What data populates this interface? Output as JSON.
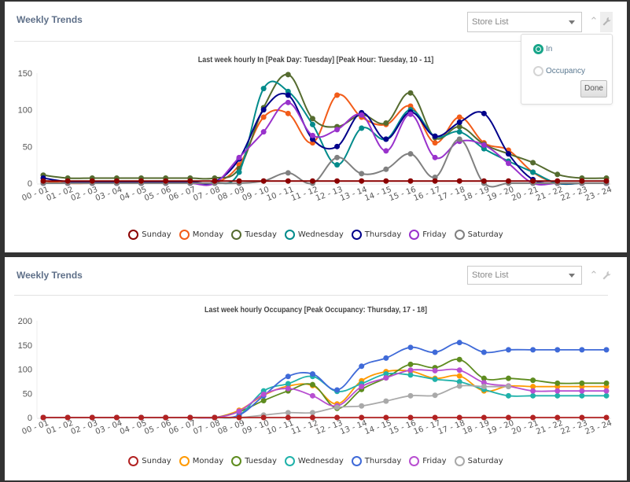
{
  "panels": [
    {
      "title": "Weekly Trends",
      "store_select": {
        "placeholder": "Store List"
      },
      "popup": {
        "visible": true,
        "options": [
          {
            "label": "In",
            "selected": true
          },
          {
            "label": "Occupancy",
            "selected": false
          }
        ],
        "done_label": "Done"
      }
    },
    {
      "title": "Weekly Trends",
      "store_select": {
        "placeholder": "Store List"
      }
    }
  ],
  "chart_data": [
    {
      "type": "line",
      "title": "Last week hourly In [Peak Day: Tuesday] [Peak Hour: Tuesday, 10 - 11]",
      "xlabel": "",
      "ylabel": "",
      "ylim": [
        0,
        150
      ],
      "yticks": [
        0,
        50,
        100,
        150
      ],
      "grid": false,
      "legend": "bottom",
      "categories": [
        "00 - 01",
        "01 - 02",
        "02 - 03",
        "03 - 04",
        "04 - 05",
        "05 - 06",
        "06 - 07",
        "07 - 08",
        "08 - 09",
        "09 - 10",
        "10 - 11",
        "11 - 12",
        "12 - 13",
        "13 - 14",
        "14 - 15",
        "15 - 16",
        "16 - 17",
        "17 - 18",
        "18 - 19",
        "19 - 20",
        "20 - 21",
        "21 - 22",
        "22 - 23",
        "23 - 24"
      ],
      "series": [
        {
          "name": "Sunday",
          "color": "#8b0000",
          "values": [
            3,
            3,
            3,
            3,
            3,
            3,
            3,
            3,
            3,
            3,
            3,
            3,
            3,
            3,
            3,
            3,
            3,
            3,
            3,
            3,
            3,
            3,
            3,
            3
          ]
        },
        {
          "name": "Monday",
          "color": "#f25c19",
          "values": [
            3,
            0,
            0,
            0,
            0,
            0,
            0,
            0,
            25,
            90,
            95,
            55,
            120,
            90,
            80,
            105,
            55,
            90,
            55,
            45,
            15,
            0,
            0,
            0
          ]
        },
        {
          "name": "Tuesday",
          "color": "#556b2f",
          "values": [
            11,
            7,
            7,
            7,
            7,
            7,
            7,
            7,
            20,
            103,
            148,
            88,
            77,
            93,
            82,
            123,
            62,
            77,
            53,
            40,
            28,
            12,
            7,
            7
          ]
        },
        {
          "name": "Wednesday",
          "color": "#008b8b",
          "values": [
            0,
            0,
            0,
            0,
            0,
            0,
            0,
            0,
            15,
            129,
            125,
            80,
            25,
            75,
            60,
            100,
            64,
            70,
            47,
            30,
            15,
            0,
            0,
            0
          ]
        },
        {
          "name": "Thursday",
          "color": "#00008b",
          "values": [
            7,
            2,
            2,
            2,
            2,
            2,
            2,
            2,
            33,
            100,
            120,
            60,
            50,
            96,
            60,
            97,
            64,
            83,
            95,
            40,
            5,
            0,
            0,
            0
          ]
        },
        {
          "name": "Friday",
          "color": "#9932cc",
          "values": [
            0,
            0,
            0,
            0,
            0,
            0,
            0,
            0,
            35,
            70,
            110,
            65,
            73,
            93,
            44,
            94,
            35,
            57,
            52,
            27,
            0,
            0,
            0,
            0
          ]
        },
        {
          "name": "Saturday",
          "color": "#808080",
          "values": [
            0,
            0,
            0,
            0,
            0,
            0,
            0,
            0,
            0,
            3,
            14,
            0,
            35,
            13,
            19,
            40,
            8,
            60,
            0,
            0,
            0,
            0,
            0,
            0
          ]
        }
      ]
    },
    {
      "type": "line",
      "title": "Last week hourly Occupancy [Peak Occupancy: Thursday, 17 - 18]",
      "xlabel": "",
      "ylabel": "",
      "ylim": [
        0,
        200
      ],
      "yticks": [
        0,
        50,
        100,
        150,
        200
      ],
      "grid": false,
      "legend": "bottom",
      "categories": [
        "00 - 01",
        "01 - 02",
        "02 - 03",
        "03 - 04",
        "04 - 05",
        "05 - 06",
        "06 - 07",
        "07 - 08",
        "08 - 09",
        "09 - 10",
        "10 - 11",
        "11 - 12",
        "12 - 13",
        "13 - 14",
        "14 - 15",
        "15 - 16",
        "16 - 17",
        "17 - 18",
        "18 - 19",
        "19 - 20",
        "20 - 21",
        "21 - 22",
        "22 - 23",
        "23 - 24"
      ],
      "series": [
        {
          "name": "Sunday",
          "color": "#b22222",
          "values": [
            0,
            0,
            0,
            0,
            0,
            0,
            0,
            0,
            0,
            0,
            0,
            0,
            0,
            0,
            0,
            0,
            0,
            0,
            0,
            0,
            0,
            0,
            0,
            0
          ]
        },
        {
          "name": "Monday",
          "color": "#ff9900",
          "values": [
            0,
            0,
            0,
            0,
            0,
            0,
            0,
            0,
            15,
            46,
            65,
            66,
            28,
            76,
            95,
            96,
            81,
            86,
            55,
            65,
            64,
            64,
            64,
            64
          ]
        },
        {
          "name": "Tuesday",
          "color": "#5e8c1f",
          "values": [
            0,
            0,
            0,
            0,
            0,
            0,
            0,
            0,
            12,
            35,
            55,
            68,
            19,
            58,
            82,
            110,
            103,
            120,
            81,
            81,
            77,
            71,
            71,
            71
          ]
        },
        {
          "name": "Wednesday",
          "color": "#20b2aa",
          "values": [
            0,
            0,
            0,
            0,
            0,
            0,
            0,
            0,
            5,
            55,
            70,
            85,
            54,
            70,
            90,
            88,
            79,
            74,
            58,
            45,
            45,
            45,
            45,
            45
          ]
        },
        {
          "name": "Thursday",
          "color": "#3f6ad8",
          "values": [
            0,
            0,
            0,
            0,
            0,
            0,
            0,
            0,
            5,
            45,
            85,
            90,
            57,
            106,
            123,
            145,
            135,
            155,
            135,
            140,
            140,
            140,
            140,
            140
          ]
        },
        {
          "name": "Friday",
          "color": "#b84fd1",
          "values": [
            0,
            0,
            0,
            0,
            0,
            0,
            0,
            0,
            13,
            48,
            60,
            45,
            24,
            64,
            82,
            98,
            97,
            98,
            72,
            65,
            55,
            55,
            55,
            55
          ]
        },
        {
          "name": "Saturday",
          "color": "#a9a9a9",
          "values": [
            0,
            0,
            0,
            0,
            0,
            0,
            0,
            0,
            0,
            5,
            10,
            10,
            21,
            24,
            34,
            45,
            46,
            65,
            64,
            64,
            null,
            null,
            null,
            null
          ]
        }
      ]
    }
  ]
}
